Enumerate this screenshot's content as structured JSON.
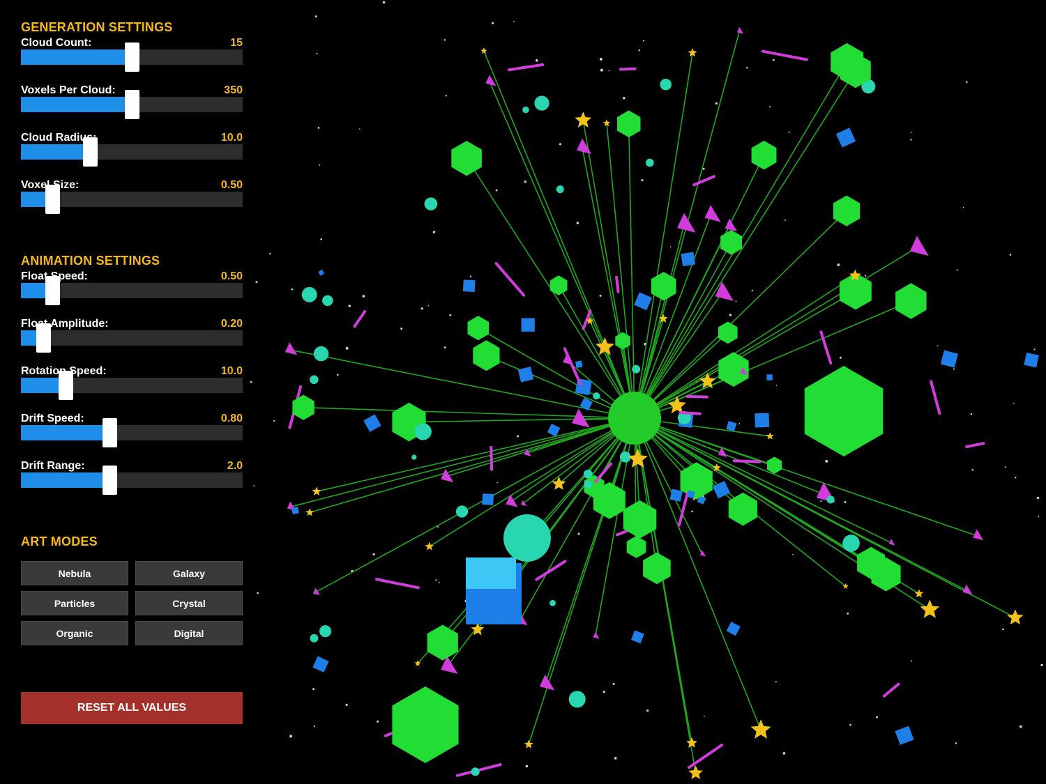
{
  "generation": {
    "title": "GENERATION SETTINGS",
    "controls": [
      {
        "label": "Cloud Count:",
        "value": "15",
        "fraction": 0.5
      },
      {
        "label": "Voxels Per Cloud:",
        "value": "350",
        "fraction": 0.5
      },
      {
        "label": "Cloud Radius:",
        "value": "10.0",
        "fraction": 0.31
      },
      {
        "label": "Voxel Size:",
        "value": "0.50",
        "fraction": 0.14
      }
    ]
  },
  "animation": {
    "title": "ANIMATION SETTINGS",
    "controls": [
      {
        "label": "Float Speed:",
        "value": "0.50",
        "fraction": 0.14
      },
      {
        "label": "Float Amplitude:",
        "value": "0.20",
        "fraction": 0.1
      },
      {
        "label": "Rotation Speed:",
        "value": "10.0",
        "fraction": 0.2
      },
      {
        "label": "Drift Speed:",
        "value": "0.80",
        "fraction": 0.4
      },
      {
        "label": "Drift Range:",
        "value": "2.0",
        "fraction": 0.4
      }
    ]
  },
  "art_modes": {
    "title": "ART MODES",
    "buttons": [
      "Nebula",
      "Galaxy",
      "Particles",
      "Crystal",
      "Organic",
      "Digital"
    ]
  },
  "reset_label": "RESET ALL VALUES",
  "colors": {
    "accent": "#f6b91c",
    "slider_fill": "#1f8ee8",
    "reset": "#a3302a",
    "green_shape": "#22dd33",
    "blue_shape": "#1f7fe8",
    "magenta_shape": "#d33cdc",
    "teal_shape": "#28d6b0",
    "gold_shape": "#f2c21a",
    "orange_shape": "#e8621e"
  }
}
